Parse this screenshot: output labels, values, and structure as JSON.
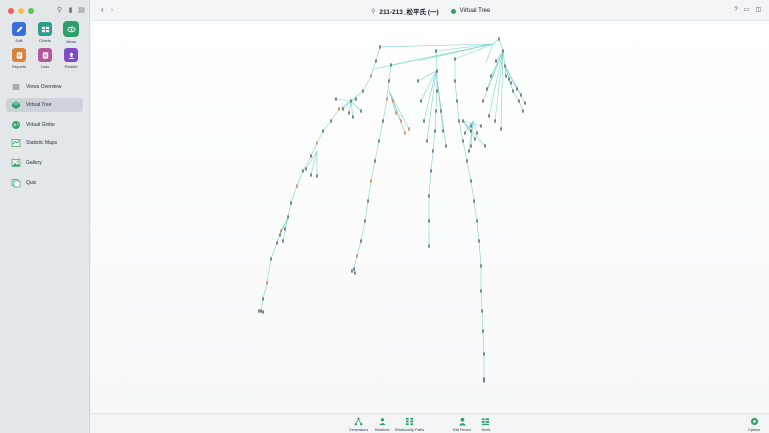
{
  "window": {
    "file_title": "211-213_松平氏 (一)",
    "view_title": "Virtual Tree"
  },
  "apps": [
    {
      "label": "Edit",
      "icon": "pencil-icon",
      "color": "#3b6fd8"
    },
    {
      "label": "Charts",
      "icon": "charts-icon",
      "color": "#2e9b8b"
    },
    {
      "label": "Views",
      "icon": "eye-icon",
      "color": "#2f9e6b"
    },
    {
      "label": "Reports",
      "icon": "reports-icon",
      "color": "#d4853b"
    },
    {
      "label": "Lists",
      "icon": "lists-icon",
      "color": "#b4579a"
    },
    {
      "label": "Publish",
      "icon": "publish-icon",
      "color": "#7b4cc2"
    }
  ],
  "nav": [
    {
      "label": "Views Overview",
      "icon": "list-icon",
      "active": false
    },
    {
      "label": "Virtual Tree",
      "icon": "tree-icon",
      "active": true
    },
    {
      "label": "Virtual Globe",
      "icon": "globe-icon",
      "active": false
    },
    {
      "label": "Statistic Maps",
      "icon": "map-icon",
      "active": false
    },
    {
      "label": "Gallery",
      "icon": "gallery-icon",
      "active": false
    },
    {
      "label": "Quiz",
      "icon": "quiz-icon",
      "active": false
    }
  ],
  "toolbar": [
    {
      "label": "Generations",
      "icon": "generations-icon"
    },
    {
      "label": "Relatives",
      "icon": "relatives-icon"
    },
    {
      "label": "Relationship Paths",
      "icon": "relationship-paths-icon"
    },
    {
      "label": "Edit Person",
      "icon": "person-icon"
    },
    {
      "label": "Views",
      "icon": "views-icon"
    },
    {
      "label": "Options",
      "icon": "options-icon"
    }
  ],
  "colors": {
    "accent_green": "#2f9e6b",
    "tree_line": "#7fd3c8",
    "node": "#6b7b8c",
    "node_highlight": "#e08a5a"
  }
}
